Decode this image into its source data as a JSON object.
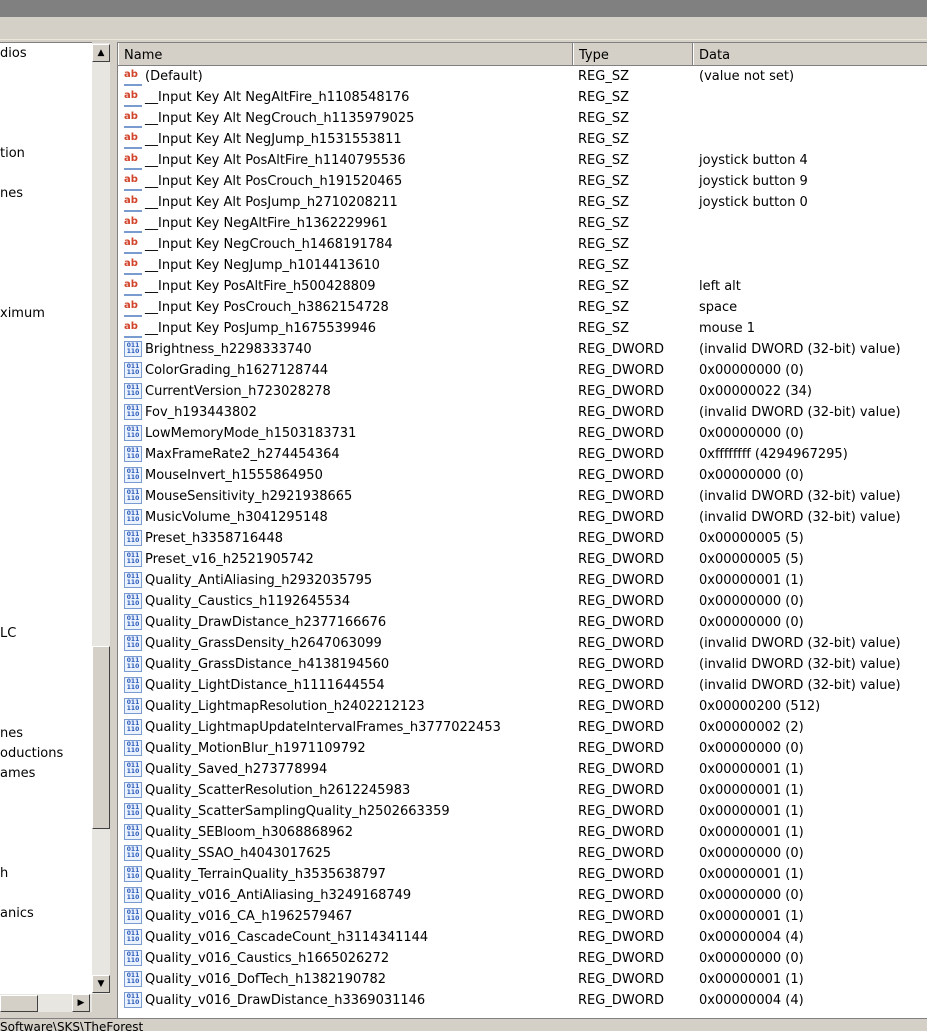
{
  "tree": {
    "items": [
      {
        "label": "dios"
      },
      {
        "label": "tion"
      },
      {
        "label": "nes"
      },
      {
        "label": "ximum"
      },
      {
        "label": "LC"
      },
      {
        "label": "nes"
      },
      {
        "label": "oductions"
      },
      {
        "label": "ames"
      },
      {
        "label": "h"
      },
      {
        "label": "anics"
      }
    ]
  },
  "list": {
    "columns": {
      "name": "Name",
      "type": "Type",
      "data": "Data"
    },
    "rows": [
      {
        "name": "(Default)",
        "type": "REG_SZ",
        "data": "(value not set)",
        "icon": "string-value-icon"
      },
      {
        "name": "__Input Key Alt NegAltFire_h1108548176",
        "type": "REG_SZ",
        "data": "",
        "icon": "string-value-icon"
      },
      {
        "name": "__Input Key Alt NegCrouch_h1135979025",
        "type": "REG_SZ",
        "data": "",
        "icon": "string-value-icon"
      },
      {
        "name": "__Input Key Alt NegJump_h1531553811",
        "type": "REG_SZ",
        "data": "",
        "icon": "string-value-icon"
      },
      {
        "name": "__Input Key Alt PosAltFire_h1140795536",
        "type": "REG_SZ",
        "data": "joystick button 4",
        "icon": "string-value-icon"
      },
      {
        "name": "__Input Key Alt PosCrouch_h191520465",
        "type": "REG_SZ",
        "data": "joystick button 9",
        "icon": "string-value-icon"
      },
      {
        "name": "__Input Key Alt PosJump_h2710208211",
        "type": "REG_SZ",
        "data": "joystick button 0",
        "icon": "string-value-icon"
      },
      {
        "name": "__Input Key NegAltFire_h1362229961",
        "type": "REG_SZ",
        "data": "",
        "icon": "string-value-icon"
      },
      {
        "name": "__Input Key NegCrouch_h1468191784",
        "type": "REG_SZ",
        "data": "",
        "icon": "string-value-icon"
      },
      {
        "name": "__Input Key NegJump_h1014413610",
        "type": "REG_SZ",
        "data": "",
        "icon": "string-value-icon"
      },
      {
        "name": "__Input Key PosAltFire_h500428809",
        "type": "REG_SZ",
        "data": "left alt",
        "icon": "string-value-icon"
      },
      {
        "name": "__Input Key PosCrouch_h3862154728",
        "type": "REG_SZ",
        "data": "space",
        "icon": "string-value-icon"
      },
      {
        "name": "__Input Key PosJump_h1675539946",
        "type": "REG_SZ",
        "data": "mouse 1",
        "icon": "string-value-icon"
      },
      {
        "name": "Brightness_h2298333740",
        "type": "REG_DWORD",
        "data": "(invalid DWORD (32-bit) value)",
        "icon": "dword-value-icon"
      },
      {
        "name": "ColorGrading_h1627128744",
        "type": "REG_DWORD",
        "data": "0x00000000 (0)",
        "icon": "dword-value-icon"
      },
      {
        "name": "CurrentVersion_h723028278",
        "type": "REG_DWORD",
        "data": "0x00000022 (34)",
        "icon": "dword-value-icon"
      },
      {
        "name": "Fov_h193443802",
        "type": "REG_DWORD",
        "data": "(invalid DWORD (32-bit) value)",
        "icon": "dword-value-icon"
      },
      {
        "name": "LowMemoryMode_h1503183731",
        "type": "REG_DWORD",
        "data": "0x00000000 (0)",
        "icon": "dword-value-icon"
      },
      {
        "name": "MaxFrameRate2_h274454364",
        "type": "REG_DWORD",
        "data": "0xffffffff (4294967295)",
        "icon": "dword-value-icon"
      },
      {
        "name": "MouseInvert_h1555864950",
        "type": "REG_DWORD",
        "data": "0x00000000 (0)",
        "icon": "dword-value-icon"
      },
      {
        "name": "MouseSensitivity_h2921938665",
        "type": "REG_DWORD",
        "data": "(invalid DWORD (32-bit) value)",
        "icon": "dword-value-icon"
      },
      {
        "name": "MusicVolume_h3041295148",
        "type": "REG_DWORD",
        "data": "(invalid DWORD (32-bit) value)",
        "icon": "dword-value-icon"
      },
      {
        "name": "Preset_h3358716448",
        "type": "REG_DWORD",
        "data": "0x00000005 (5)",
        "icon": "dword-value-icon"
      },
      {
        "name": "Preset_v16_h2521905742",
        "type": "REG_DWORD",
        "data": "0x00000005 (5)",
        "icon": "dword-value-icon"
      },
      {
        "name": "Quality_AntiAliasing_h2932035795",
        "type": "REG_DWORD",
        "data": "0x00000001 (1)",
        "icon": "dword-value-icon"
      },
      {
        "name": "Quality_Caustics_h1192645534",
        "type": "REG_DWORD",
        "data": "0x00000000 (0)",
        "icon": "dword-value-icon"
      },
      {
        "name": "Quality_DrawDistance_h2377166676",
        "type": "REG_DWORD",
        "data": "0x00000000 (0)",
        "icon": "dword-value-icon"
      },
      {
        "name": "Quality_GrassDensity_h2647063099",
        "type": "REG_DWORD",
        "data": "(invalid DWORD (32-bit) value)",
        "icon": "dword-value-icon"
      },
      {
        "name": "Quality_GrassDistance_h4138194560",
        "type": "REG_DWORD",
        "data": "(invalid DWORD (32-bit) value)",
        "icon": "dword-value-icon"
      },
      {
        "name": "Quality_LightDistance_h1111644554",
        "type": "REG_DWORD",
        "data": "(invalid DWORD (32-bit) value)",
        "icon": "dword-value-icon"
      },
      {
        "name": "Quality_LightmapResolution_h2402212123",
        "type": "REG_DWORD",
        "data": "0x00000200 (512)",
        "icon": "dword-value-icon"
      },
      {
        "name": "Quality_LightmapUpdateIntervalFrames_h3777022453",
        "type": "REG_DWORD",
        "data": "0x00000002 (2)",
        "icon": "dword-value-icon"
      },
      {
        "name": "Quality_MotionBlur_h1971109792",
        "type": "REG_DWORD",
        "data": "0x00000000 (0)",
        "icon": "dword-value-icon"
      },
      {
        "name": "Quality_Saved_h273778994",
        "type": "REG_DWORD",
        "data": "0x00000001 (1)",
        "icon": "dword-value-icon"
      },
      {
        "name": "Quality_ScatterResolution_h2612245983",
        "type": "REG_DWORD",
        "data": "0x00000001 (1)",
        "icon": "dword-value-icon"
      },
      {
        "name": "Quality_ScatterSamplingQuality_h2502663359",
        "type": "REG_DWORD",
        "data": "0x00000001 (1)",
        "icon": "dword-value-icon"
      },
      {
        "name": "Quality_SEBloom_h3068868962",
        "type": "REG_DWORD",
        "data": "0x00000001 (1)",
        "icon": "dword-value-icon"
      },
      {
        "name": "Quality_SSAO_h4043017625",
        "type": "REG_DWORD",
        "data": "0x00000000 (0)",
        "icon": "dword-value-icon"
      },
      {
        "name": "Quality_TerrainQuality_h3535638797",
        "type": "REG_DWORD",
        "data": "0x00000001 (1)",
        "icon": "dword-value-icon"
      },
      {
        "name": "Quality_v016_AntiAliasing_h3249168749",
        "type": "REG_DWORD",
        "data": "0x00000000 (0)",
        "icon": "dword-value-icon"
      },
      {
        "name": "Quality_v016_CA_h1962579467",
        "type": "REG_DWORD",
        "data": "0x00000001 (1)",
        "icon": "dword-value-icon"
      },
      {
        "name": "Quality_v016_CascadeCount_h3114341144",
        "type": "REG_DWORD",
        "data": "0x00000004 (4)",
        "icon": "dword-value-icon"
      },
      {
        "name": "Quality_v016_Caustics_h1665026272",
        "type": "REG_DWORD",
        "data": "0x00000000 (0)",
        "icon": "dword-value-icon"
      },
      {
        "name": "Quality_v016_DofTech_h1382190782",
        "type": "REG_DWORD",
        "data": "0x00000001 (1)",
        "icon": "dword-value-icon"
      },
      {
        "name": "Quality_v016_DrawDistance_h3369031146",
        "type": "REG_DWORD",
        "data": "0x00000004 (4)",
        "icon": "dword-value-icon"
      }
    ]
  },
  "status": {
    "path": "Software\\SKS\\TheForest"
  },
  "colors": {
    "window_bg": "#d4d0c8",
    "list_bg": "#ffffff",
    "string_icon": "#d2442b",
    "dword_icon": "#2a5ab8"
  }
}
